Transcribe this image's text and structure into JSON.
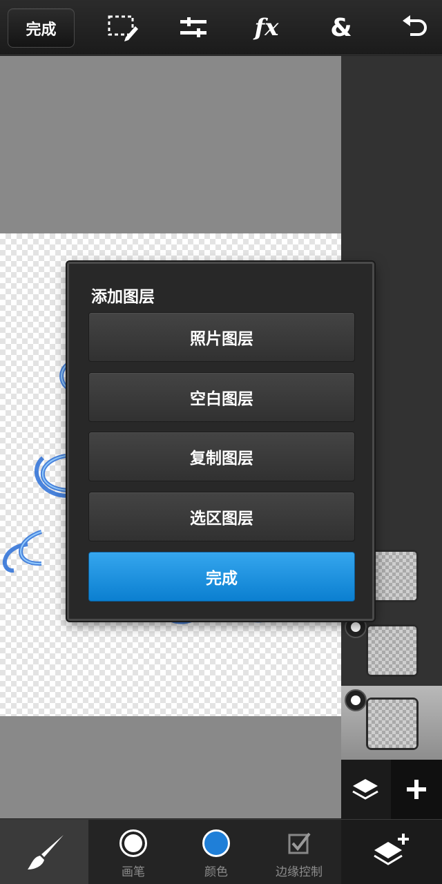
{
  "toolbar": {
    "done_label": "完成",
    "icons": [
      "selection-icon",
      "adjustments-icon",
      "fx-icon",
      "blend-icon",
      "undo-icon"
    ],
    "fx_label": "fx",
    "amp_label": "&"
  },
  "dialog": {
    "title": "添加图层",
    "options": [
      "照片图层",
      "空白图层",
      "复制图层",
      "选区图层"
    ],
    "confirm_label": "完成",
    "accent_color": "#1a8fe0"
  },
  "layers": {
    "items": [
      {
        "selected": false,
        "visible_toggle": false
      },
      {
        "selected": false,
        "visible_toggle": true
      },
      {
        "selected": true,
        "visible_toggle": true
      }
    ]
  },
  "bottom_toolbar": {
    "brush_label": "画笔",
    "color_label": "颜色",
    "edge_label": "边缘控制",
    "brush_color": "#ffffff",
    "active_color": "#1f7fd8"
  }
}
